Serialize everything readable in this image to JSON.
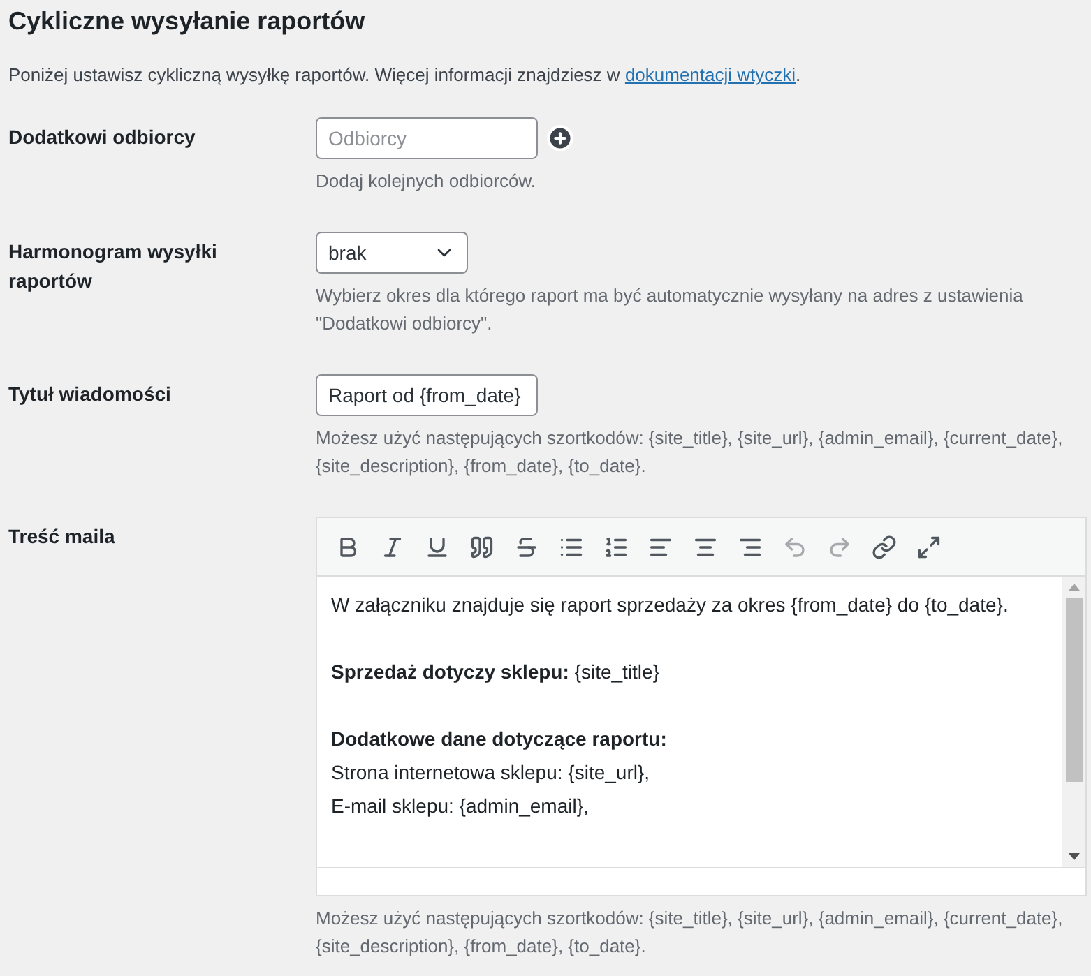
{
  "title": "Cykliczne wysyłanie raportów",
  "intro": {
    "text": "Poniżej ustawisz cykliczną wysyłkę raportów. Więcej informacji znajdziesz w ",
    "link": "dokumentacji wtyczki",
    "after": "."
  },
  "fields": [
    {
      "kind": "recipients",
      "label": "Dodatkowi odbiorcy",
      "placeholder": "Odbiorcy",
      "description": "Dodaj kolejnych odbiorców."
    },
    {
      "kind": "select",
      "label": "Harmonogram wysyłki raportów",
      "value": "brak",
      "description": "Wybierz okres dla którego raport ma być automatycznie wysyłany na adres z ustawienia \"Dodatkowi odbiorcy\"."
    },
    {
      "kind": "text",
      "label": "Tytuł wiadomości",
      "value": "Raport od {from_date}",
      "description": "Możesz użyć następujących szortkodów: {site_title}, {site_url}, {admin_email}, {current_date}, {site_description}, {from_date}, {to_date}."
    },
    {
      "kind": "editor",
      "label": "Treść maila",
      "description": "Możesz użyć następujących szortkodów: {site_title}, {site_url}, {admin_email}, {current_date}, {site_description}, {from_date}, {to_date}."
    }
  ],
  "editor": {
    "toolbar": [
      {
        "kind": "bold",
        "disabled": false
      },
      {
        "kind": "italic",
        "disabled": false
      },
      {
        "kind": "underline",
        "disabled": false
      },
      {
        "kind": "quote",
        "disabled": false
      },
      {
        "kind": "strike",
        "disabled": false
      },
      {
        "kind": "bullets",
        "disabled": false
      },
      {
        "kind": "numbers",
        "disabled": false
      },
      {
        "kind": "align-left",
        "disabled": false
      },
      {
        "kind": "align-center",
        "disabled": false
      },
      {
        "kind": "align-right",
        "disabled": false
      },
      {
        "kind": "undo",
        "disabled": true
      },
      {
        "kind": "redo",
        "disabled": true
      },
      {
        "kind": "link",
        "disabled": false
      },
      {
        "kind": "fullscreen",
        "disabled": false
      }
    ],
    "paragraphs": [
      [
        "W załączniku znajduje się raport sprzedaży za okres {from_date} do {to_date}."
      ],
      [
        "**Sprzedaż dotyczy sklepu:** {site_title}"
      ],
      [
        "**Dodatkowe dane dotyczące raportu:**",
        "Strona internetowa sklepu: {site_url},",
        "E-mail sklepu: {admin_email},"
      ]
    ]
  }
}
